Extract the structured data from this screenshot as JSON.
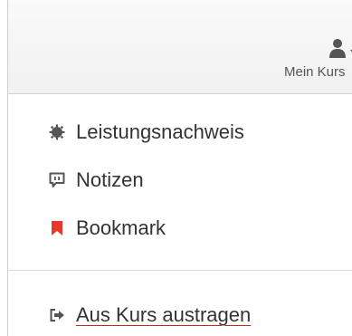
{
  "header": {
    "user_menu_label": "Mein Kurs",
    "user_icon": "user-icon",
    "caret_icon": "caret-down-icon"
  },
  "menu": {
    "items": [
      {
        "label": "Leistungsnachweis",
        "icon": "gear-badge-icon",
        "icon_color": "#555555"
      },
      {
        "label": "Notizen",
        "icon": "comment-icon",
        "icon_color": "#555555"
      },
      {
        "label": "Bookmark",
        "icon": "bookmark-icon",
        "icon_color": "#e8382c"
      }
    ],
    "logout": {
      "label": "Aus Kurs austragen",
      "icon": "sign-out-icon",
      "icon_color": "#555555"
    }
  }
}
